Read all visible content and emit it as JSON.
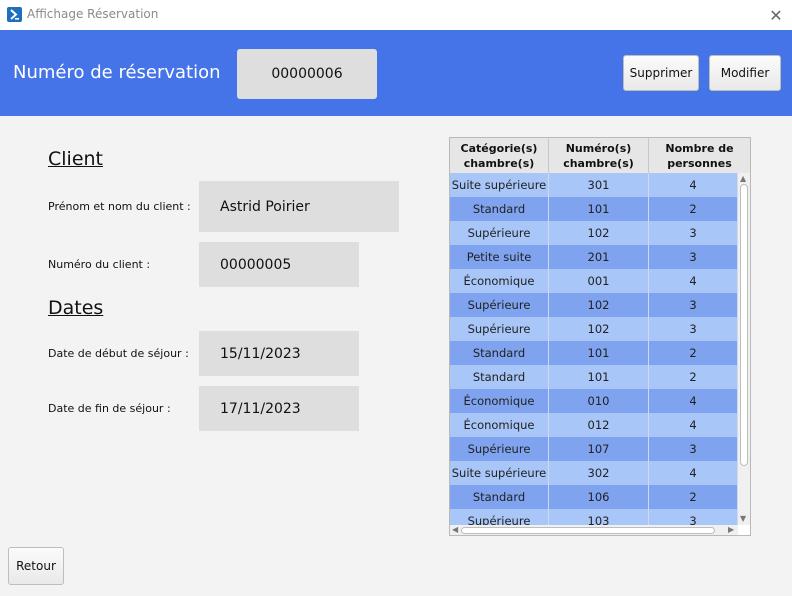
{
  "window": {
    "title": "Affichage Réservation",
    "icon": "app-logo-icon",
    "close_icon": "close-icon",
    "close_glyph": "✕"
  },
  "header": {
    "label": "Numéro de réservation",
    "reservation_number": "00000006",
    "delete_label": "Supprimer",
    "edit_label": "Modifier",
    "background": "#4474e8"
  },
  "client": {
    "section_title": "Client",
    "name_label": "Prénom et nom du client :",
    "name_value": "Astrid  Poirier",
    "number_label": "Numéro du client :",
    "number_value": "00000005"
  },
  "dates": {
    "section_title": "Dates",
    "start_label": "Date de début de séjour :",
    "start_value": "15/11/2023",
    "end_label": "Date de fin de séjour :",
    "end_value": "17/11/2023"
  },
  "table": {
    "headers": [
      [
        "Catégorie(s)",
        "chambre(s)"
      ],
      [
        "Numéro(s)",
        "chambre(s)"
      ],
      [
        "Nombre de",
        "personnes"
      ]
    ],
    "rows": [
      [
        "Suite supérieure",
        "301",
        "4"
      ],
      [
        "Standard",
        "101",
        "2"
      ],
      [
        "Supérieure",
        "102",
        "3"
      ],
      [
        "Petite suite",
        "201",
        "3"
      ],
      [
        "Économique",
        "001",
        "4"
      ],
      [
        "Supérieure",
        "102",
        "3"
      ],
      [
        "Supérieure",
        "102",
        "3"
      ],
      [
        "Standard",
        "101",
        "2"
      ],
      [
        "Standard",
        "101",
        "2"
      ],
      [
        "Économique",
        "010",
        "4"
      ],
      [
        "Économique",
        "012",
        "4"
      ],
      [
        "Supérieure",
        "107",
        "3"
      ],
      [
        "Suite supérieure",
        "302",
        "4"
      ],
      [
        "Standard",
        "106",
        "2"
      ],
      [
        "Supérieure",
        "103",
        "3"
      ]
    ],
    "row_colors": {
      "odd": "#a8c6f7",
      "even": "#7fa3ee"
    }
  },
  "footer": {
    "back_label": "Retour"
  }
}
